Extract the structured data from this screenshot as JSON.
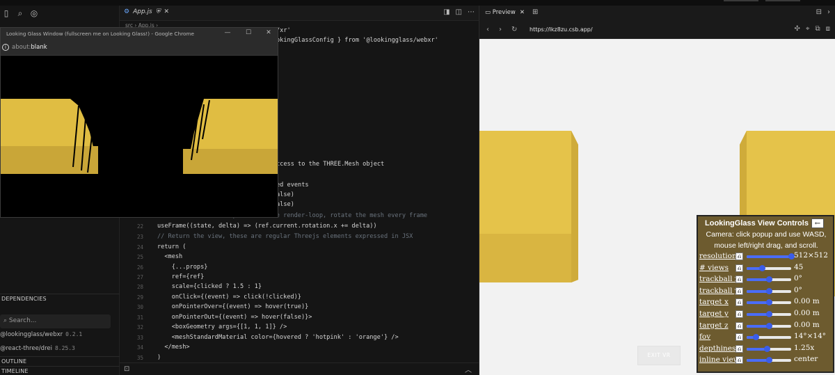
{
  "sidebar": {
    "dependencies_label": "DEPENDENCIES",
    "search_placeholder": "Search...",
    "dependencies": [
      {
        "name": "@lookingglass/webxr",
        "version": "0.2.1"
      },
      {
        "name": "@react-three/drei",
        "version": "8.25.3"
      }
    ],
    "outline_label": "OUTLINE",
    "timeline_label": "TIMELINE"
  },
  "editor": {
    "tab_label": "App.js",
    "breadcrumb": "src › App.js ›",
    "lines": [
      {
        "n": "",
        "html": "/xr'"
      },
      {
        "n": "",
        "html": "okingGlassConfig } from '@lookingglass/webxr'"
      },
      {
        "n": "",
        "html": "ccess to the THREE.Mesh object"
      },
      {
        "n": "",
        "html": "ed events"
      },
      {
        "n": "",
        "html": "alse)"
      },
      {
        "n": "",
        "html": "alse)"
      },
      {
        "n": "",
        "html": "// Subscribe this component to the render-loop, rotate the mesh every frame"
      },
      {
        "n": "22",
        "html": "useFrame((state, delta) => (ref.current.rotation.x += delta))"
      },
      {
        "n": "23",
        "html": "// Return the view, these are regular Threejs elements expressed in JSX"
      },
      {
        "n": "24",
        "html": "return ("
      },
      {
        "n": "25",
        "html": "  <mesh"
      },
      {
        "n": "26",
        "html": "    {...props}"
      },
      {
        "n": "27",
        "html": "    ref={ref}"
      },
      {
        "n": "28",
        "html": "    scale={clicked ? 1.5 : 1}"
      },
      {
        "n": "29",
        "html": "    onClick={(event) => click(!clicked)}"
      },
      {
        "n": "30",
        "html": "    onPointerOver={(event) => hover(true)}"
      },
      {
        "n": "31",
        "html": "    onPointerOut={(event) => hover(false)}>"
      },
      {
        "n": "32",
        "html": "    <boxGeometry args={[1, 1, 1]} />"
      },
      {
        "n": "33",
        "html": "    <meshStandardMaterial color={hovered ? 'hotpink' : 'orange'} />"
      },
      {
        "n": "34",
        "html": "  </mesh>"
      },
      {
        "n": "35",
        "html": ")"
      }
    ]
  },
  "preview": {
    "tab_label": "Preview",
    "url": "https://lkz8zu.csb.app/",
    "exit_vr_label": "EXIT VR"
  },
  "lg_controls": {
    "title": "LookingGlass View Controls",
    "back_label": "←",
    "description": "Camera: click popup and use WASD, mouse left/right drag, and scroll.",
    "reset_glyph": "⎌",
    "rows": [
      {
        "label": "resolution",
        "value": "512×512",
        "level": 1.0
      },
      {
        "label": "# views",
        "value": "45",
        "level": 0.35
      },
      {
        "label": "trackball x",
        "value": "0°",
        "level": 0.5
      },
      {
        "label": "trackball y",
        "value": "0°",
        "level": 0.5
      },
      {
        "label": "target x",
        "value": "0.00 m",
        "level": 0.5
      },
      {
        "label": "target y",
        "value": "0.00 m",
        "level": 0.5
      },
      {
        "label": "target z",
        "value": "0.00 m",
        "level": 0.5
      },
      {
        "label": "fov",
        "value": "14°×14°",
        "level": 0.2
      },
      {
        "label": "depthiness",
        "value": "1.25x",
        "level": 0.45
      },
      {
        "label": "inline view",
        "value": "center",
        "level": 0.5
      }
    ]
  },
  "popup": {
    "title": "Looking Glass Window (fullscreen me on Looking Glass!) - Google Chrome",
    "url_prefix": "about:",
    "url_bold": "blank"
  },
  "colors": {
    "cube_yellow": "#e5c34a",
    "cube_side": "#d3af3c",
    "slider_blue": "#4a6cf7",
    "panel_bg": "#6d5b2f"
  }
}
